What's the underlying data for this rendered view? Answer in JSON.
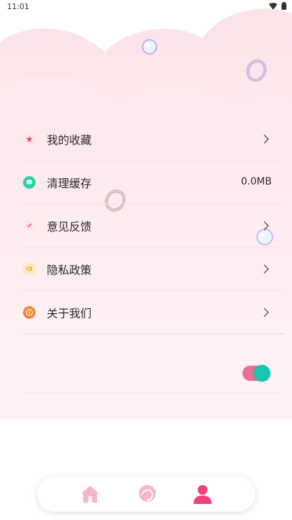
{
  "status_bar": {
    "time": "11:01"
  },
  "menu": {
    "items": [
      {
        "label": "我的收藏",
        "icon": "star-icon",
        "icon_color": "#e84a5f",
        "value": ""
      },
      {
        "label": "清理缓存",
        "icon": "chat-icon",
        "icon_color": "#2ad1a6",
        "value": "0.0MB"
      },
      {
        "label": "意见反馈",
        "icon": "pen-icon",
        "icon_color": "#ef6b6b",
        "value": ""
      },
      {
        "label": "隐私政策",
        "icon": "message-icon",
        "icon_color": "#f4b23a",
        "value": ""
      },
      {
        "label": "关于我们",
        "icon": "info-icon",
        "icon_color": "#f08a3a",
        "value": ""
      }
    ]
  },
  "toggle": {
    "state": "on",
    "track_color": "#ef6f94",
    "knob_color": "#16c7b0"
  },
  "tab_bar": {
    "tabs": [
      {
        "name": "home",
        "icon": "home-icon",
        "active": false
      },
      {
        "name": "discover",
        "icon": "face-profile-icon",
        "active": false
      },
      {
        "name": "me",
        "icon": "person-icon",
        "active": true
      }
    ],
    "active_color": "#f2417a",
    "inactive_color": "#f7b6c8"
  }
}
